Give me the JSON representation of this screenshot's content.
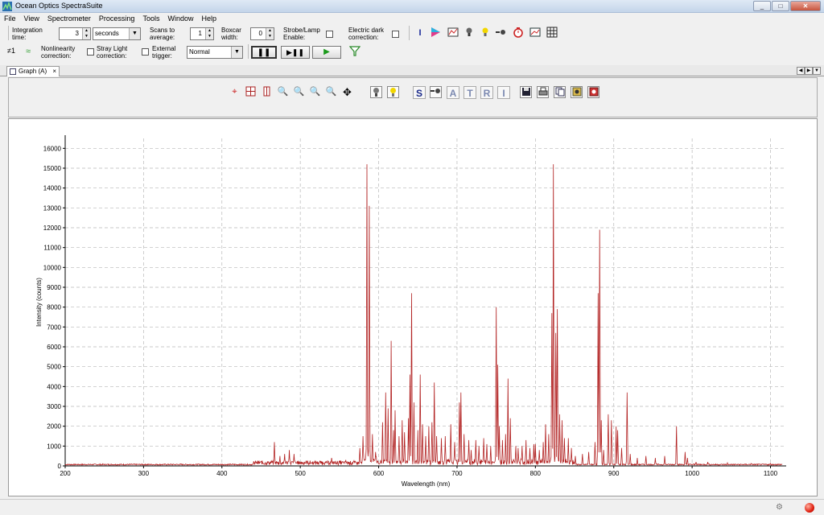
{
  "window": {
    "title": "Ocean Optics SpectraSuite",
    "min": "_",
    "max": "□",
    "close": "✕"
  },
  "menu": [
    "File",
    "View",
    "Spectrometer",
    "Processing",
    "Tools",
    "Window",
    "Help"
  ],
  "toolbar": {
    "integration_label_1": "Integration",
    "integration_label_2": "time:",
    "integration_value": "3",
    "integration_unit": "seconds",
    "scans_label_1": "Scans to",
    "scans_label_2": "average:",
    "scans_value": "1",
    "boxcar_label_1": "Boxcar",
    "boxcar_label_2": "width:",
    "boxcar_value": "0",
    "strobe_label_1": "Strobe/Lamp",
    "strobe_label_2": "Enable:",
    "dark_label_1": "Electric dark",
    "dark_label_2": "correction:",
    "neq_label": "≠1",
    "nonlin_label_1": "Nonlinearity",
    "nonlin_label_2": "correction:",
    "stray_label_1": "Stray Light",
    "stray_label_2": "correction:",
    "ext_label_1": "External",
    "ext_label_2": "trigger:",
    "trigger_mode": "Normal",
    "pause_glyph": "❚❚",
    "step_glyph": "▶❚❚",
    "play_glyph": "▶"
  },
  "tab": {
    "label": "Graph (A)",
    "close": "×"
  },
  "graph_toolbar_letters": [
    "S",
    "A",
    "T",
    "R",
    "I"
  ],
  "chart_data": {
    "type": "line",
    "title": "",
    "xlabel": "Wavelength (nm)",
    "ylabel": "Intensity (counts)",
    "xlim": [
      200,
      1120
    ],
    "ylim": [
      0,
      16500
    ],
    "xticks": [
      200,
      300,
      400,
      500,
      600,
      700,
      800,
      900,
      1000,
      1100
    ],
    "yticks": [
      0,
      1000,
      2000,
      3000,
      4000,
      5000,
      6000,
      7000,
      8000,
      9000,
      10000,
      11000,
      12000,
      13000,
      14000,
      15000,
      16000
    ],
    "grid": true,
    "color": "#b22222",
    "series": [
      {
        "peaks": [
          [
            467,
            1200
          ],
          [
            474,
            500
          ],
          [
            480,
            600
          ],
          [
            486,
            800
          ],
          [
            492,
            600
          ],
          [
            540,
            400
          ],
          [
            558,
            300
          ],
          [
            576,
            900
          ],
          [
            580,
            1500
          ],
          [
            585,
            15200
          ],
          [
            588,
            13100
          ],
          [
            592,
            1600
          ],
          [
            596,
            700
          ],
          [
            605,
            2200
          ],
          [
            609,
            3700
          ],
          [
            612,
            2900
          ],
          [
            616,
            6300
          ],
          [
            619,
            1800
          ],
          [
            621,
            2800
          ],
          [
            626,
            1500
          ],
          [
            630,
            2300
          ],
          [
            633,
            1700
          ],
          [
            638,
            2400
          ],
          [
            640,
            4600
          ],
          [
            642,
            8700
          ],
          [
            645,
            3200
          ],
          [
            650,
            1800
          ],
          [
            653,
            4600
          ],
          [
            656,
            2100
          ],
          [
            660,
            1500
          ],
          [
            664,
            2000
          ],
          [
            668,
            2200
          ],
          [
            671,
            4200
          ],
          [
            674,
            1500
          ],
          [
            680,
            1400
          ],
          [
            685,
            1500
          ],
          [
            692,
            2100
          ],
          [
            697,
            1200
          ],
          [
            703,
            3200
          ],
          [
            705,
            3700
          ],
          [
            709,
            1600
          ],
          [
            715,
            1300
          ],
          [
            718,
            800
          ],
          [
            724,
            1300
          ],
          [
            728,
            1000
          ],
          [
            734,
            1400
          ],
          [
            738,
            1100
          ],
          [
            743,
            1000
          ],
          [
            750,
            8000
          ],
          [
            752,
            5100
          ],
          [
            754,
            2000
          ],
          [
            758,
            1300
          ],
          [
            762,
            1600
          ],
          [
            765,
            4400
          ],
          [
            768,
            2400
          ],
          [
            775,
            1000
          ],
          [
            778,
            900
          ],
          [
            783,
            1000
          ],
          [
            788,
            1300
          ],
          [
            793,
            900
          ],
          [
            798,
            1100
          ],
          [
            800,
            1100
          ],
          [
            805,
            800
          ],
          [
            810,
            1200
          ],
          [
            813,
            2100
          ],
          [
            817,
            1600
          ],
          [
            821,
            7700
          ],
          [
            823,
            15200
          ],
          [
            826,
            6700
          ],
          [
            828,
            7900
          ],
          [
            831,
            2600
          ],
          [
            834,
            2300
          ],
          [
            837,
            1400
          ],
          [
            842,
            1400
          ],
          [
            846,
            900
          ],
          [
            851,
            500
          ],
          [
            860,
            600
          ],
          [
            868,
            700
          ],
          [
            876,
            1200
          ],
          [
            880,
            8700
          ],
          [
            882,
            11900
          ],
          [
            884,
            2300
          ],
          [
            887,
            800
          ],
          [
            893,
            2600
          ],
          [
            897,
            2300
          ],
          [
            903,
            2000
          ],
          [
            905,
            1800
          ],
          [
            910,
            900
          ],
          [
            917,
            3700
          ],
          [
            921,
            600
          ],
          [
            930,
            400
          ],
          [
            941,
            500
          ],
          [
            953,
            400
          ],
          [
            965,
            500
          ],
          [
            980,
            2000
          ],
          [
            991,
            700
          ],
          [
            994,
            400
          ],
          [
            1005,
            200
          ],
          [
            1020,
            200
          ],
          [
            1045,
            150
          ],
          [
            1075,
            120
          ],
          [
            1100,
            120
          ]
        ]
      }
    ]
  }
}
